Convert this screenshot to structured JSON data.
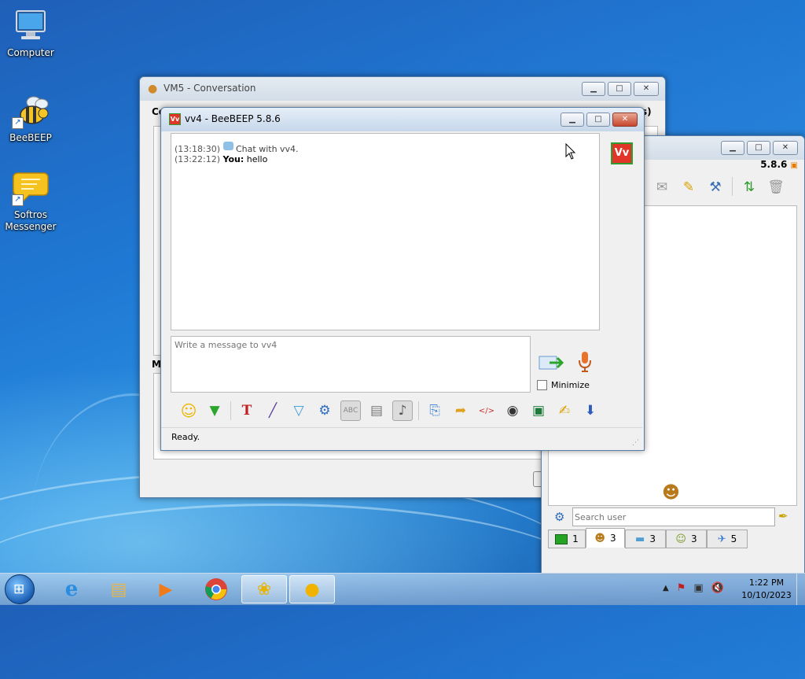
{
  "desktop": {
    "icons": [
      {
        "label": "Computer",
        "icon": "computer-icon"
      },
      {
        "label": "BeeBEEP",
        "icon": "bee-icon"
      },
      {
        "label": "Softros Messenger",
        "icon": "speech-bubble-icon"
      }
    ]
  },
  "conversation_window": {
    "title": "VM5 - Conversation",
    "label_left_top": "Co",
    "label_left_mid": "M",
    "label_right_top": "s)"
  },
  "chat_window": {
    "title": "vv4 - BeeBEEP 5.8.6",
    "avatar_text": "Vv",
    "messages": [
      {
        "time": "(13:18:30)",
        "sender": "",
        "text": "Chat with vv4."
      },
      {
        "time": "(13:22:12)",
        "sender": "You:",
        "text": "hello"
      }
    ],
    "input_placeholder": "Write a message to vv4",
    "minimize_label": "Minimize",
    "status": "Ready.",
    "toolbar_icons": [
      "smiley-icon",
      "download-icon",
      "font-icon",
      "color-picker-icon",
      "filter-icon",
      "settings-gear-icon",
      "spellcheck-icon",
      "document-icon",
      "music-note-icon",
      "send-file-icon",
      "send-folder-icon",
      "html-code-icon",
      "webcam-icon",
      "screenshot-icon",
      "note-edit-icon",
      "save-icon"
    ]
  },
  "main_window": {
    "version": "5.8.6",
    "toolbar_icons": [
      "mail-icon",
      "edit-icon",
      "tools-icon",
      "update-icon",
      "trash-icon"
    ],
    "search_placeholder": "Search user",
    "tabs": [
      {
        "icon": "chat-tab-icon",
        "count": "1"
      },
      {
        "icon": "users-tab-icon",
        "count": "3"
      },
      {
        "icon": "messages-tab-icon",
        "count": "3"
      },
      {
        "icon": "groups-tab-icon",
        "count": "3"
      },
      {
        "icon": "network-tab-icon",
        "count": "5"
      }
    ]
  },
  "taskbar": {
    "clock_time": "1:22 PM",
    "clock_date": "10/10/2023",
    "apps": [
      "internet-explorer-icon",
      "file-explorer-icon",
      "media-player-icon",
      "chrome-icon",
      "beebeep-taskbar-icon",
      "softros-taskbar-icon"
    ]
  }
}
